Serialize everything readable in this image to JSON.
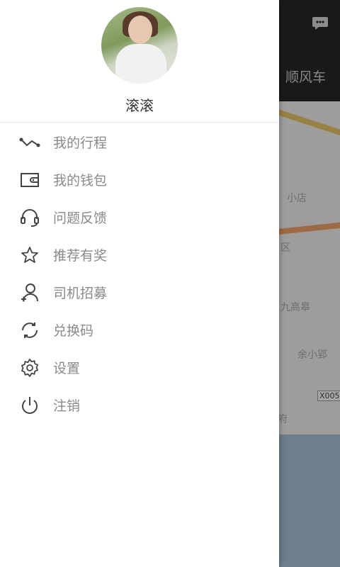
{
  "background": {
    "tab_label": "顺风车",
    "map_places": [
      "小店",
      "区",
      "九高皋",
      "余小郢",
      "府"
    ],
    "road_marker": "X005"
  },
  "drawer": {
    "username": "滚滚",
    "menu": [
      {
        "label": "我的行程",
        "icon": "trip-icon"
      },
      {
        "label": "我的钱包",
        "icon": "wallet-icon"
      },
      {
        "label": "问题反馈",
        "icon": "headset-icon"
      },
      {
        "label": "推荐有奖",
        "icon": "star-icon"
      },
      {
        "label": "司机招募",
        "icon": "add-user-icon"
      },
      {
        "label": "兑换码",
        "icon": "exchange-icon"
      },
      {
        "label": "设置",
        "icon": "settings-gear-icon"
      },
      {
        "label": "注销",
        "icon": "power-icon"
      }
    ]
  },
  "colors": {
    "drawer_bg": "#ffffff",
    "topbar_bg": "#272727",
    "menu_text": "#8a8a8a",
    "icon_stroke": "#444444"
  }
}
